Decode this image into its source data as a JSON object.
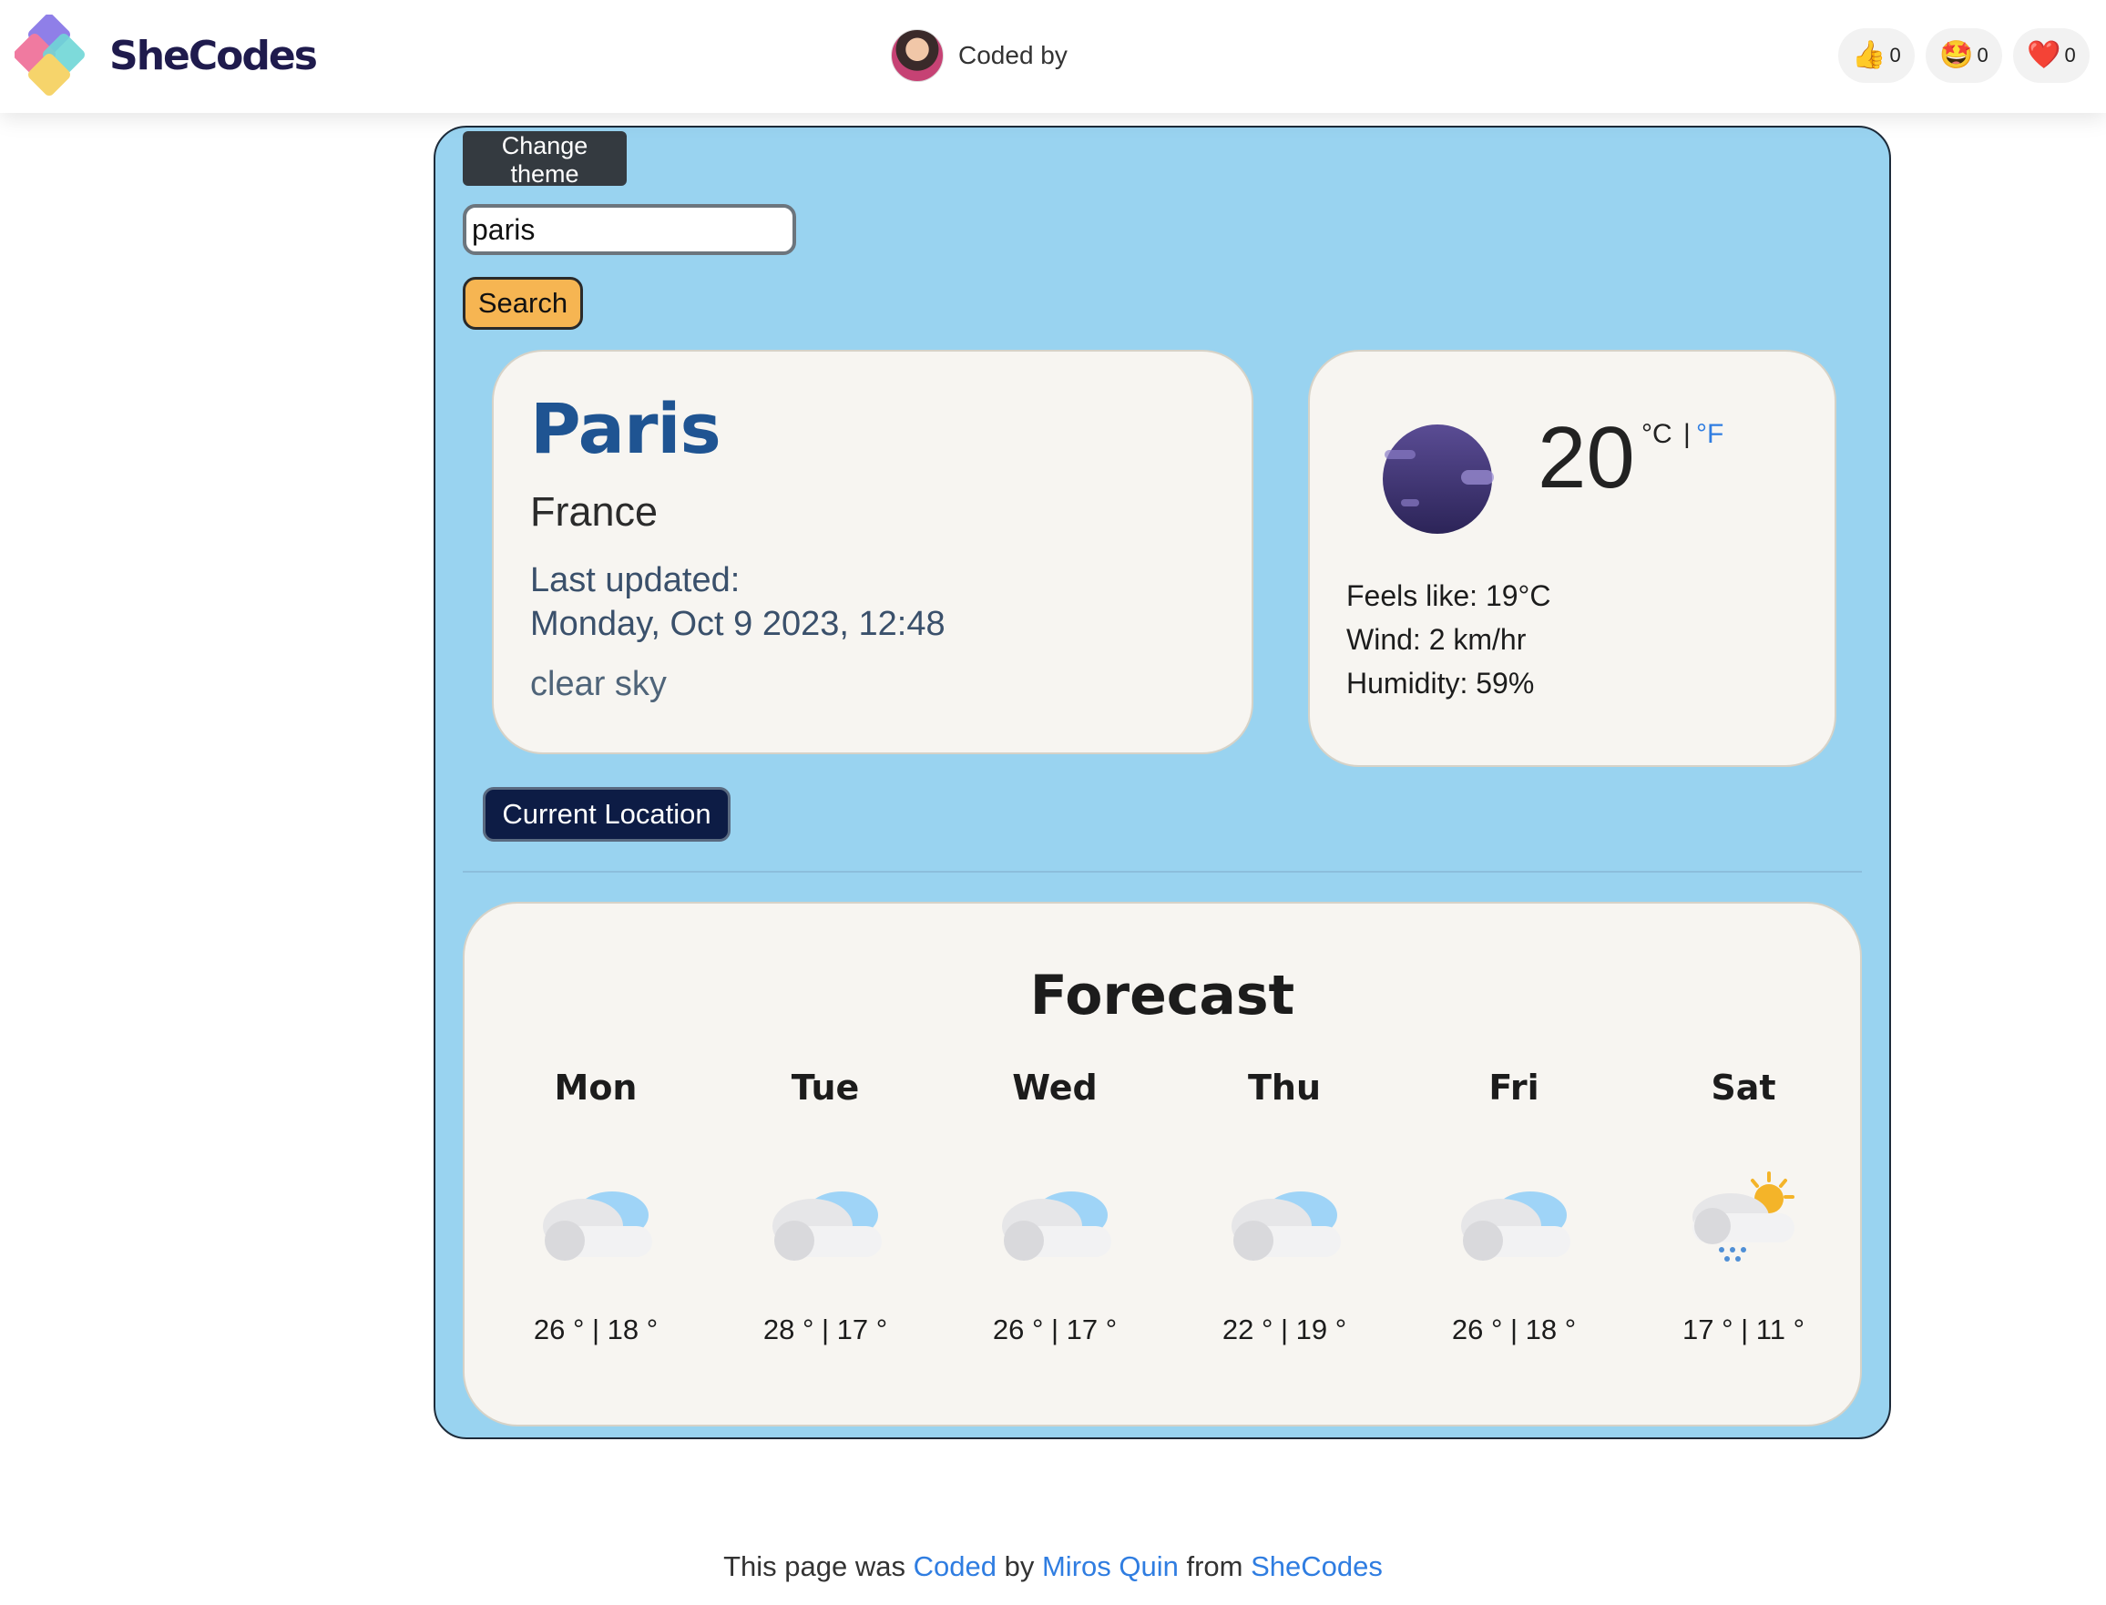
{
  "header": {
    "brand_name": "SheCodes",
    "coded_by_text": "Coded by",
    "reactions": [
      {
        "icon": "thumbs-up-icon",
        "emoji": "👍",
        "count": "0"
      },
      {
        "icon": "star-struck-icon",
        "emoji": "🤩",
        "count": "0"
      },
      {
        "icon": "heart-icon",
        "emoji": "❤️",
        "count": "0"
      }
    ]
  },
  "app": {
    "theme_button": "Change theme",
    "search": {
      "value": "paris",
      "button": "Search"
    },
    "city": {
      "name": "Paris",
      "country": "France",
      "last_updated_label": "Last updated:",
      "last_updated_date": "Monday, Oct 9 2023, 12:48",
      "description": "clear sky"
    },
    "current": {
      "icon": "clear-night-moon-icon",
      "temperature": "20",
      "unit_c": "°C",
      "unit_sep": "|",
      "unit_f": "°F",
      "feels_like": "Feels like: 19°C",
      "wind": "Wind: 2 km/hr",
      "humidity": "Humidity: 59%"
    },
    "location_button": "Current Location",
    "forecast": {
      "title": "Forecast",
      "days": [
        {
          "day": "Mon",
          "icon": "cloudy-icon",
          "temps": "26 ° | 18 °"
        },
        {
          "day": "Tue",
          "icon": "cloudy-icon",
          "temps": "28 ° | 17 °"
        },
        {
          "day": "Wed",
          "icon": "cloudy-icon",
          "temps": "26 ° | 17 °"
        },
        {
          "day": "Thu",
          "icon": "cloudy-icon",
          "temps": "22 ° | 19 °"
        },
        {
          "day": "Fri",
          "icon": "cloudy-icon",
          "temps": "26 ° | 18 °"
        },
        {
          "day": "Sat",
          "icon": "sun-rain-icon",
          "temps": "17 ° | 11 °"
        }
      ]
    }
  },
  "footer": {
    "prefix": "This page was",
    "coded_link": "Coded",
    "by": "by",
    "author_link": "Miros Quin",
    "from": "from",
    "shecodes_link": "SheCodes"
  },
  "colors": {
    "app_background": "#99d3f0",
    "card_background": "#f7f5f1",
    "city_name": "#1f5492",
    "search_button": "#f6b552",
    "location_button": "#0d1c45",
    "link": "#2f7de1"
  }
}
